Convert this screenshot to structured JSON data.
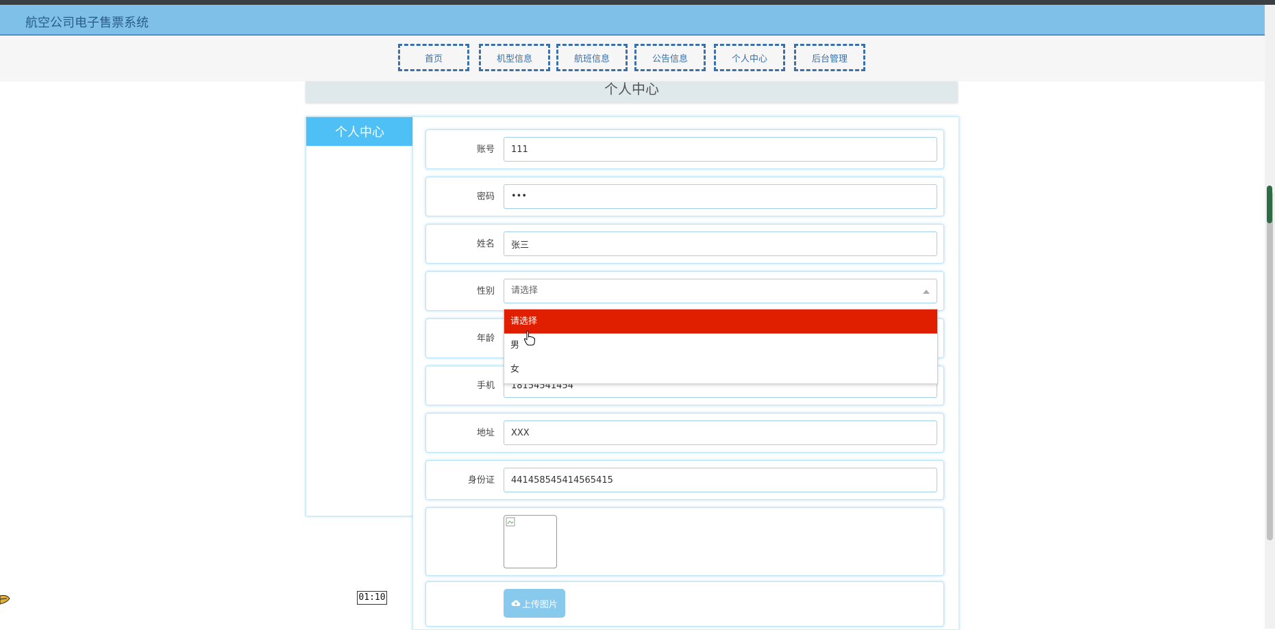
{
  "app": {
    "title": "航空公司电子售票系统"
  },
  "nav": {
    "items": [
      {
        "label": "首页"
      },
      {
        "label": "机型信息"
      },
      {
        "label": "航班信息"
      },
      {
        "label": "公告信息"
      },
      {
        "label": "个人中心"
      },
      {
        "label": "后台管理"
      }
    ]
  },
  "page": {
    "title": "个人中心"
  },
  "sidebar": {
    "active_label": "个人中心"
  },
  "form": {
    "account": {
      "label": "账号",
      "value": "111"
    },
    "password": {
      "label": "密码",
      "value": "•••"
    },
    "name": {
      "label": "姓名",
      "value": "张三"
    },
    "gender": {
      "label": "性别",
      "value": "请选择",
      "options": [
        "请选择",
        "男",
        "女"
      ],
      "highlighted": "请选择"
    },
    "age": {
      "label": "年龄",
      "value": ""
    },
    "phone": {
      "label": "手机",
      "value": "18154541454"
    },
    "address": {
      "label": "地址",
      "value": "XXX"
    },
    "idcard": {
      "label": "身份证",
      "value": "441458545414565415"
    },
    "upload": {
      "label": "上传图片"
    }
  },
  "overlay": {
    "timer": "01:10"
  },
  "colors": {
    "header_bg": "#7fc0e8",
    "nav_border": "#3b6fa6",
    "sidebar_active": "#4fc0f5",
    "dropdown_highlight": "#e01e00",
    "upload_button": "#88c9ee"
  }
}
